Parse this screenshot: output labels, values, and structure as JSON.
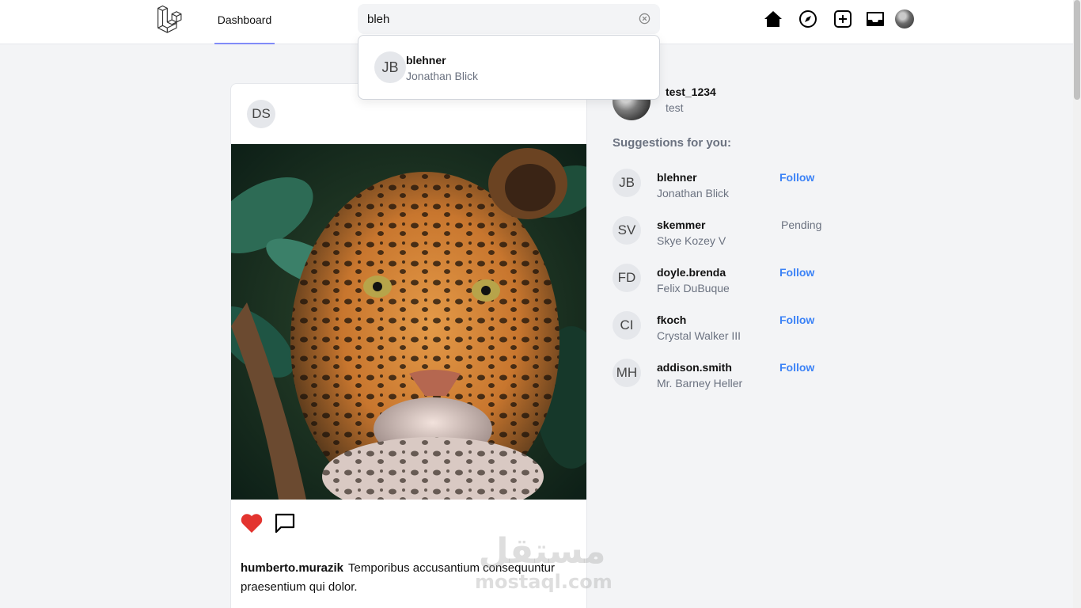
{
  "nav": {
    "dashboard_label": "Dashboard",
    "search_value": "bleh",
    "icons": [
      "home-icon",
      "explore-icon",
      "create-post-icon",
      "inbox-icon"
    ]
  },
  "search_results": [
    {
      "initials": "JB",
      "username": "blehner",
      "name": "Jonathan Blick"
    }
  ],
  "post": {
    "author_initials": "DS",
    "image_description": "jaguar-photo",
    "caption_user": "humberto.murazik",
    "caption_text": "Temporibus accusantium consequuntur praesentium qui dolor.",
    "liked": true
  },
  "current_user": {
    "username": "test_1234",
    "name": "test"
  },
  "suggestions": {
    "title": "Suggestions for you:",
    "items": [
      {
        "initials": "JB",
        "username": "blehner",
        "name": "Jonathan Blick",
        "action": "Follow",
        "status": "follow"
      },
      {
        "initials": "SV",
        "username": "skemmer",
        "name": "Skye Kozey V",
        "action": "Pending",
        "status": "pending"
      },
      {
        "initials": "FD",
        "username": "doyle.brenda",
        "name": "Felix DuBuque",
        "action": "Follow",
        "status": "follow"
      },
      {
        "initials": "CI",
        "username": "fkoch",
        "name": "Crystal Walker III",
        "action": "Follow",
        "status": "follow"
      },
      {
        "initials": "MH",
        "username": "addison.smith",
        "name": "Mr. Barney Heller",
        "action": "Follow",
        "status": "follow"
      }
    ]
  },
  "watermark": {
    "arabic": "مستقل",
    "latin": "mostaql.com"
  },
  "colors": {
    "accent": "#818cf8",
    "link": "#3b82f6",
    "like": "#e3342f",
    "background": "#f3f4f6"
  }
}
